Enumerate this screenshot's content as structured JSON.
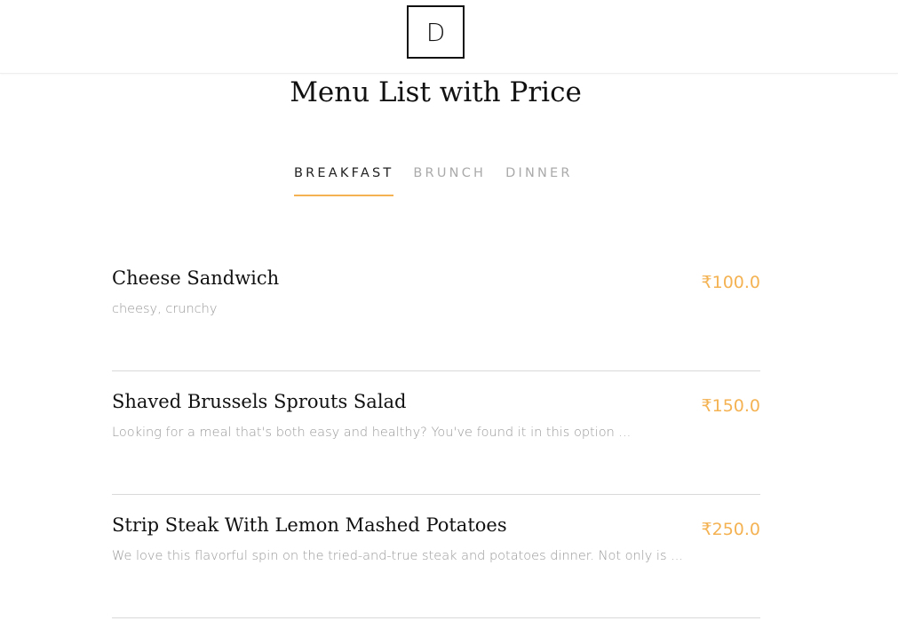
{
  "header": {
    "logo_text": "D"
  },
  "page_title": "Menu List with Price",
  "tabs": [
    {
      "label": "BREAKFAST",
      "active": true
    },
    {
      "label": "BRUNCH",
      "active": false
    },
    {
      "label": "DINNER",
      "active": false
    }
  ],
  "menu_items": [
    {
      "name": "Cheese Sandwich",
      "description": "cheesy, crunchy",
      "price": "₹100.0"
    },
    {
      "name": "Shaved Brussels Sprouts Salad",
      "description": "Looking for a meal that's both easy and healthy? You've found it in this option ...",
      "price": "₹150.0"
    },
    {
      "name": "Strip Steak With Lemon Mashed Potatoes",
      "description": "We love this flavorful spin on the tried-and-true steak and potatoes dinner. Not only is ...",
      "price": "₹250.0"
    }
  ],
  "colors": {
    "accent": "#f4b252",
    "text": "#111111",
    "muted": "#999999",
    "inactive_tab": "#aaaaaa"
  }
}
